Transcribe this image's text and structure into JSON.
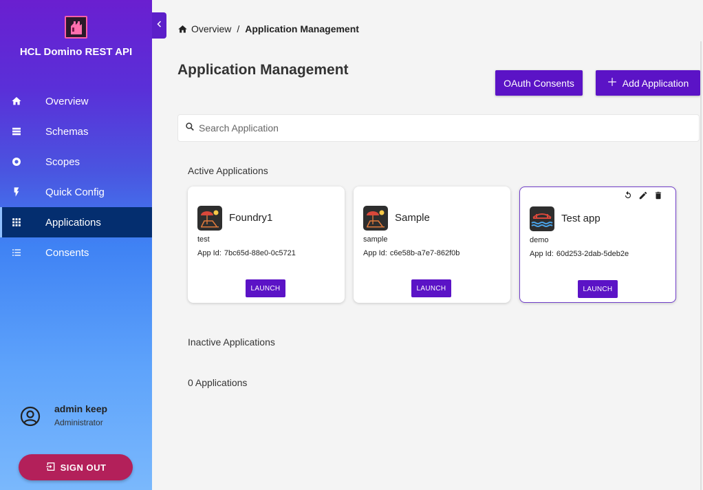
{
  "brand": {
    "title": "HCL Domino REST API"
  },
  "nav": {
    "items": [
      {
        "label": "Overview",
        "icon": "home-icon"
      },
      {
        "label": "Schemas",
        "icon": "schema-list-icon"
      },
      {
        "label": "Scopes",
        "icon": "scope-target-icon"
      },
      {
        "label": "Quick Config",
        "icon": "lightning-icon"
      },
      {
        "label": "Applications",
        "icon": "grid-icon",
        "active": true
      },
      {
        "label": "Consents",
        "icon": "list-icon"
      }
    ]
  },
  "user": {
    "name": "admin keep",
    "role": "Administrator"
  },
  "signout": {
    "label": "SIGN OUT"
  },
  "breadcrumb": {
    "home": "Overview",
    "separator": "/",
    "current": "Application Management"
  },
  "page": {
    "title": "Application Management",
    "oauth_button": "OAuth Consents",
    "add_button": "Add Application",
    "search_placeholder": "Search Application"
  },
  "active": {
    "heading": "Active Applications",
    "apps": [
      {
        "name": "Foundry1",
        "description": "test",
        "id_label": "App Id:",
        "app_id": "7bc65d-88e0-0c5721",
        "launch": "LAUNCH"
      },
      {
        "name": "Sample",
        "description": "sample",
        "id_label": "App Id:",
        "app_id": "c6e58b-a7e7-862f0b",
        "launch": "LAUNCH"
      },
      {
        "name": "Test app",
        "description": "demo",
        "id_label": "App Id:",
        "app_id": "60d253-2dab-5deb2e",
        "launch": "LAUNCH"
      }
    ]
  },
  "inactive": {
    "heading": "Inactive Applications",
    "count_text": "0 Applications"
  },
  "colors": {
    "primary": "#5b13c6",
    "signout": "#b3205a",
    "active_nav": "#042e6f"
  }
}
